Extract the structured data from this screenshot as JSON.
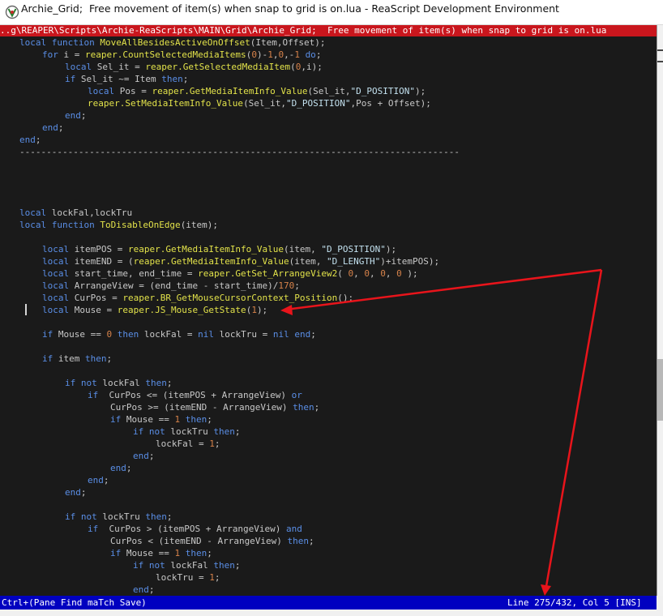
{
  "window": {
    "title": "Archie_Grid;  Free movement of item(s) when snap to grid is on.lua - ReaScript Development Environment"
  },
  "path_bar": "..g\\REAPER\\Scripts\\Archie-ReaScripts\\MAIN\\Grid\\Archie_Grid;  Free movement of item(s) when snap to grid is on.lua",
  "code_lines": [
    "local function MoveAllBesidesActiveOnOffset(Item,Offset);",
    "for i = reaper.CountSelectedMediaItems(0)-1,0,-1 do;",
    "local Sel_it = reaper.GetSelectedMediaItem(0,i);",
    "if Sel_it ~= Item then;",
    "local Pos = reaper.GetMediaItemInfo_Value(Sel_it,\"D_POSITION\");",
    "reaper.SetMediaItemInfo_Value(Sel_it,\"D_POSITION\",Pos + Offset);",
    "end;",
    "end;",
    "end;",
    "----------------------------------------------------------------------------------",
    "local lockFal,lockTru",
    "local function ToDisableOnEdge(item);",
    "local itemPOS = reaper.GetMediaItemInfo_Value(item, \"D_POSITION\");",
    "local itemEND = (reaper.GetMediaItemInfo_Value(item, \"D_LENGTH\")+itemPOS);",
    "local start_time, end_time = reaper.GetSet_ArrangeView2( 0, 0, 0, 0 );",
    "local ArrangeView = (end_time - start_time)/170;",
    "local CurPos = reaper.BR_GetMouseCursorContext_Position();",
    "local Mouse = reaper.JS_Mouse_GetState(1);",
    "if Mouse == 0 then lockFal = nil lockTru = nil end;",
    "if item then;",
    "if not lockFal then;",
    "if  CurPos <= (itemPOS + ArrangeView) or",
    "CurPos >= (itemEND - ArrangeView) then;",
    "if Mouse == 1 then;",
    "if not lockTru then;",
    "lockFal = 1;",
    "end;",
    "end;",
    "end;",
    "end;",
    "if not lockTru then;",
    "if  CurPos > (itemPOS + ArrangeView) and",
    "CurPos < (itemEND - ArrangeView) then;",
    "if Mouse == 1 then;",
    "if not lockFal then;",
    "lockTru = 1;",
    "end;"
  ],
  "status": {
    "left": "Ctrl+(Pane Find maTch Save)",
    "right": "Line 275/432, Col 5 [INS]"
  },
  "colors": {
    "background": "#1a1a1a",
    "keyword": "#5a8ee6",
    "function": "#e2e24a",
    "number": "#d6824a",
    "path_bar": "#c9161d",
    "status_bar": "#0000c0",
    "annotation_arrow": "#e8141b"
  }
}
